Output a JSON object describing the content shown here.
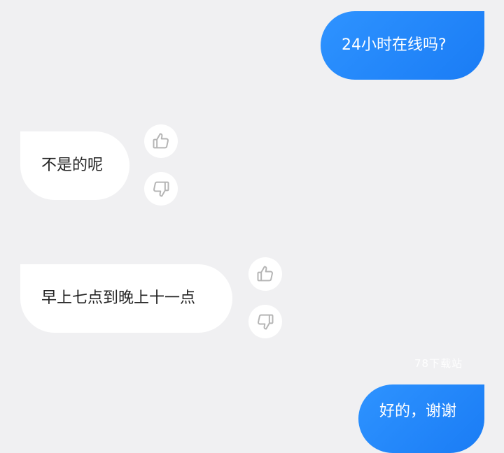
{
  "messages": [
    {
      "role": "user",
      "text": "24小时在线吗?"
    },
    {
      "role": "bot",
      "text": "不是的呢"
    },
    {
      "role": "bot",
      "text": "早上七点到晚上十一点"
    },
    {
      "role": "user",
      "text": "好的，谢谢"
    }
  ],
  "feedback_icons": {
    "like": "thumbs-up-icon",
    "dislike": "thumbs-down-icon"
  },
  "watermark": "78下载站",
  "colors": {
    "background": "#f0f0f2",
    "user_bubble": "#1a7cf5",
    "bot_bubble": "#ffffff",
    "bot_text": "#222222",
    "icon_stroke": "#b5b5b5"
  }
}
